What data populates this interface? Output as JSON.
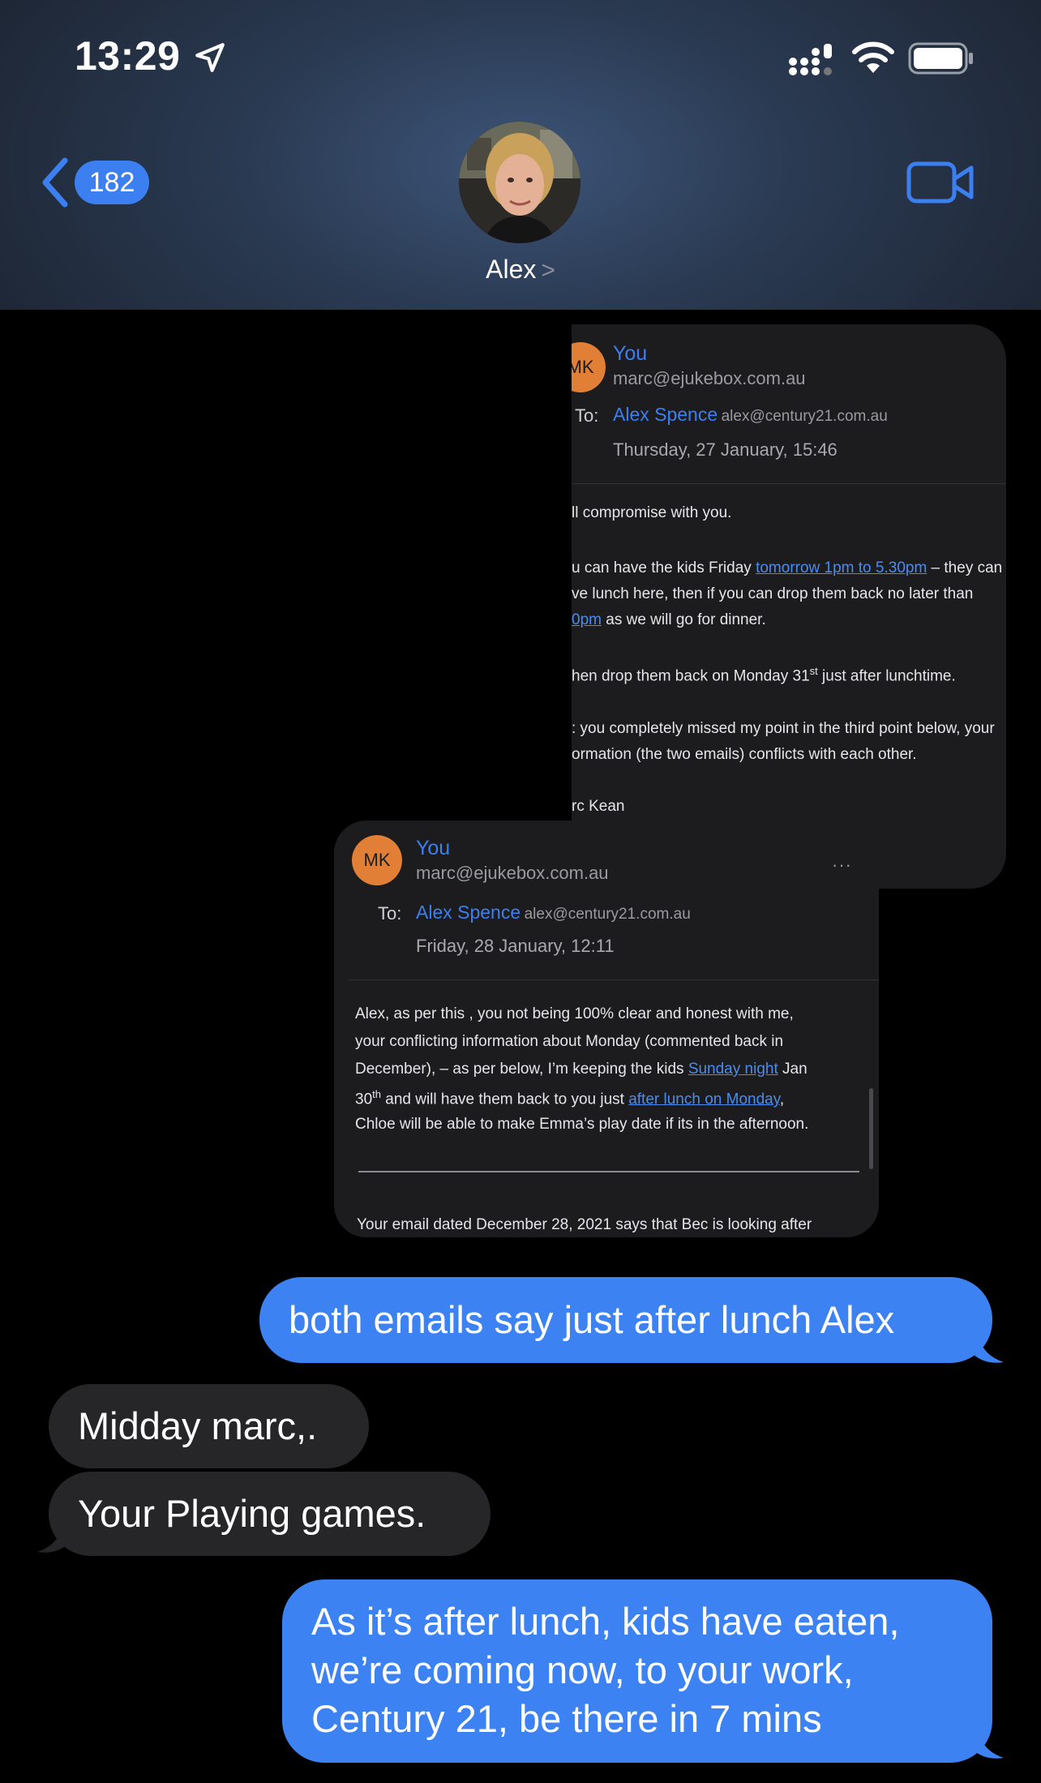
{
  "status_bar": {
    "time": "13:29"
  },
  "header": {
    "back_badge": "182",
    "contact_name": "Alex",
    "name_chevron": ">"
  },
  "email_1": {
    "avatar_initials": "MK",
    "from_name": "You",
    "from_address": "marc@ejukebox.com.au",
    "to_label": "To:",
    "to_name": "Alex Spence",
    "to_address": "alex@century21.com.au",
    "date": "Thursday, 27 January, 15:46",
    "lines": [
      {
        "pre": "ll compromise with you.",
        "link": "",
        "post": ""
      },
      {
        "pre": "u can have the kids Friday ",
        "link": "tomorrow 1pm to 5.30pm",
        "post": " – they can"
      },
      {
        "pre": "ve lunch here, then if you can drop them back no later than",
        "link": "",
        "post": ""
      },
      {
        "pre": "",
        "link": "0pm",
        "post": " as we will go for dinner."
      },
      {
        "pre": "hen drop them back on Monday 31",
        "sup": "st",
        "post": " just after lunchtime."
      },
      {
        "pre": ": you completely missed my point in the third point below, your",
        "link": "",
        "post": ""
      },
      {
        "pre": "ormation (the two emails) conflicts with each other.",
        "link": "",
        "post": ""
      },
      {
        "pre": "rc Kean",
        "link": "",
        "post": ""
      }
    ]
  },
  "email_2": {
    "avatar_initials": "MK",
    "from_name": "You",
    "from_address": "marc@ejukebox.com.au",
    "more": "···",
    "to_label": "To:",
    "to_name": "Alex Spence",
    "to_address": "alex@century21.com.au",
    "date": "Friday, 28 January, 12:11",
    "lines": [
      {
        "pre": "Alex, as per this , you not being 100% clear and honest with me,",
        "link": "",
        "post": ""
      },
      {
        "pre": "your conflicting information about Monday (commented back in",
        "link": "",
        "post": ""
      },
      {
        "pre": "December), – as per below, I’m keeping the kids ",
        "link": "Sunday night",
        "post": " Jan"
      },
      {
        "pre": "30",
        "sup": "th",
        "mid": " and will have them back to you just ",
        "link": "after lunch on Monday",
        "post": ","
      },
      {
        "pre": "Chloe will be able to make Emma’s play date if its in the afternoon.",
        "link": "",
        "post": ""
      }
    ],
    "footer_line": "Your email dated December 28, 2021 says that Bec is looking after"
  },
  "messages": [
    {
      "side": "out",
      "text": "both emails say just after lunch Alex"
    },
    {
      "side": "in",
      "text": "Midday marc,."
    },
    {
      "side": "in",
      "text": "Your Playing games."
    },
    {
      "side": "out",
      "text": "As it’s after lunch, kids have eaten, we’re coming now, to your work, Century 21, be there in 7 mins"
    }
  ],
  "colors": {
    "accent_blue": "#3c82f2",
    "incoming_bubble": "#262628",
    "avatar_orange": "#e07f35"
  }
}
